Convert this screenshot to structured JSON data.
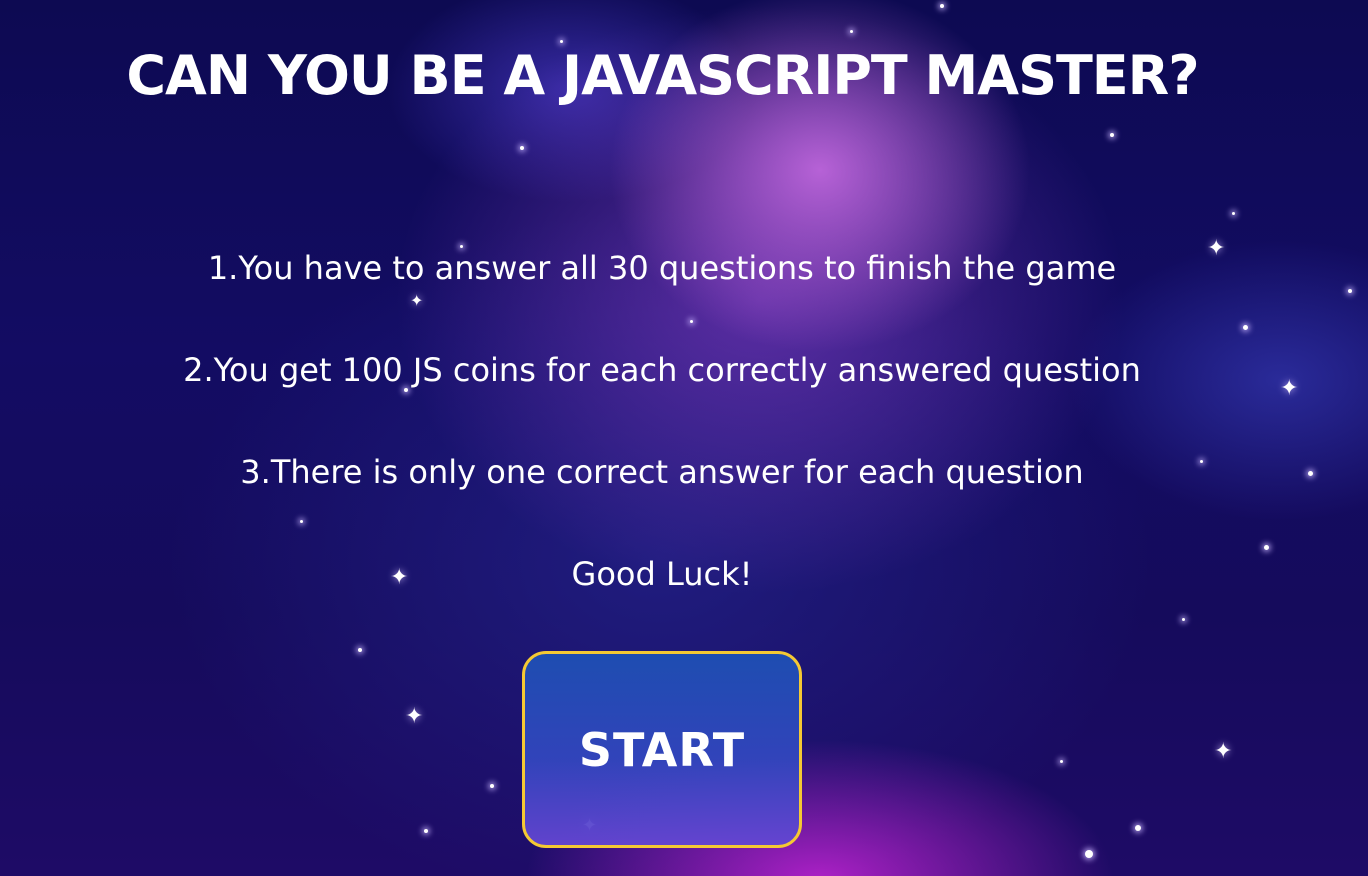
{
  "screen": {
    "title": "CAN YOU BE A JAVASCRIPT MASTER?",
    "rules": [
      "1.You have to answer all 30 questions to finish the game",
      "2.You get 100 JS coins for each correctly answered question",
      "3.There is only one correct answer for each question"
    ],
    "closing_message": "Good Luck!",
    "start_button_label": "START"
  },
  "colors": {
    "background_dark": "#0d0a52",
    "nebula_glow": "#cd6ee6",
    "text": "#ffffff",
    "button_border": "#f5c933",
    "button_fill": "#2a4fb8"
  },
  "icons": {
    "background_decoration": "sparkle-star"
  }
}
